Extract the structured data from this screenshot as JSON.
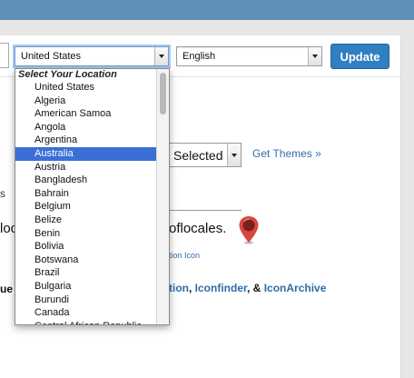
{
  "toolbar": {
    "location_value": "United States",
    "language_value": "English",
    "update_label": "Update"
  },
  "location_dropdown": {
    "header": "Select Your Location",
    "items": [
      "United States",
      "Algeria",
      "American Samoa",
      "Angola",
      "Argentina",
      "Australia",
      "Austria",
      "Bangladesh",
      "Bahrain",
      "Belgium",
      "Belize",
      "Benin",
      "Bolivia",
      "Botswana",
      "Brazil",
      "Bulgaria",
      "Burundi",
      "Canada",
      "Central African Republic"
    ],
    "selected": "Australia"
  },
  "themes": {
    "select_value": "Selected",
    "get_themes_label": "Get Themes »"
  },
  "background_fragments": {
    "s_fragment": "s",
    "loc_fragment": "loc",
    "domain_fragment": "oflocales.",
    "icon_label": "tion Icon",
    "ue_fragment": "ue"
  },
  "credits": {
    "link1": "tion",
    "sep1": ", ",
    "link2": "Iconfinder",
    "sep2": ", & ",
    "link3": "IconArchive"
  },
  "colors": {
    "topbar": "#5f8fb6",
    "accent_button": "#2f7fc1",
    "selection": "#3a6fd6",
    "link": "#2e6da8",
    "pin": "#d9463f"
  }
}
